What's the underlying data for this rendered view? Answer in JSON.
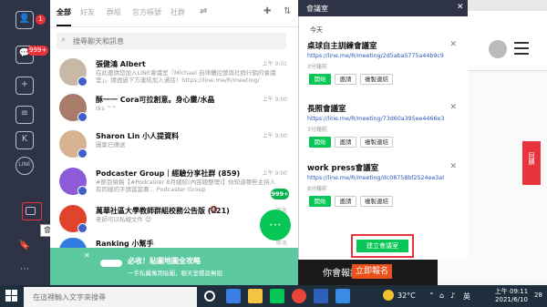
{
  "left_rail": {
    "badge": "1",
    "badge2": "999+",
    "tooltip": "會議室"
  },
  "chat": {
    "tabs": [
      "全部",
      "好友",
      "群組",
      "官方帳號",
      "社群"
    ],
    "search_placeholder": "搜尋聊天和訊息",
    "items": [
      {
        "name": "張健鴻 Albert",
        "msg": "在此邀請您加入LINE會議室「Michael 自律體控營與社群行銷的會議室」。請透過下方連結加入通話！https://line.me/R/meeting/",
        "time": "上午 9:01",
        "unread": ""
      },
      {
        "name": "酥一一 Cora可拉創意。身心靈/水晶",
        "msg": "tks ^^",
        "time": "上午 9:00",
        "unread": ""
      },
      {
        "name": "Sharon Lin 小人提資料",
        "msg": "圖案已傳送",
        "time": "上午 9:00",
        "unread": ""
      },
      {
        "name": "Podcaster Group｜經驗分享社群 (859)",
        "msg": "#節目徵稿【#Podcaster 8月總結(內容總整理)】你知道哪些主持人有同樣的手請當當賽... Podcaster Group",
        "time": "上午 9:00",
        "unread": "999+"
      },
      {
        "name": "萬華社區大學教師群組校務公告版 (121)",
        "msg": "老師可以私線文件 😊",
        "time": "昨天",
        "unread": ""
      },
      {
        "name": "Ranking 小幫手",
        "msg": "",
        "time": "昨天",
        "unread": ""
      }
    ]
  },
  "ad": {
    "title": "必收！貼圖地圖全攻略",
    "sub": "一手私藏萬用貼圖，聊天室暢談無阻"
  },
  "meeting": {
    "header": "會議室",
    "today": "今天",
    "cards": [
      {
        "title": "桌球自主訓練會議室",
        "link": "https://line.me/R/meeting/2d5aba5775a44b9c9b...",
        "ago": "3分鐘前"
      },
      {
        "title": "長照會議室",
        "link": "https://line.me/R/meeting/73d60a395ee4466e3f...",
        "ago": "3分鐘前"
      },
      {
        "title": "work press會議室",
        "link": "https://line.me/R/meeting/dc08758bf2524ee3a9...",
        "ago": "8分鐘前"
      }
    ],
    "btn_start": "開始",
    "btn_invite": "邀請",
    "btn_copy": "複製連結",
    "create": "建立會議室"
  },
  "background": {
    "banner_text": "你會報議",
    "banner_btn": "立即報名",
    "side_tab": "回饋"
  },
  "taskbar": {
    "search_placeholder": "在這裡輸入文字來搜尋",
    "temp": "32°C",
    "ime": "英",
    "time": "上午 09:11",
    "date": "2021/6/10",
    "notif": "28"
  }
}
